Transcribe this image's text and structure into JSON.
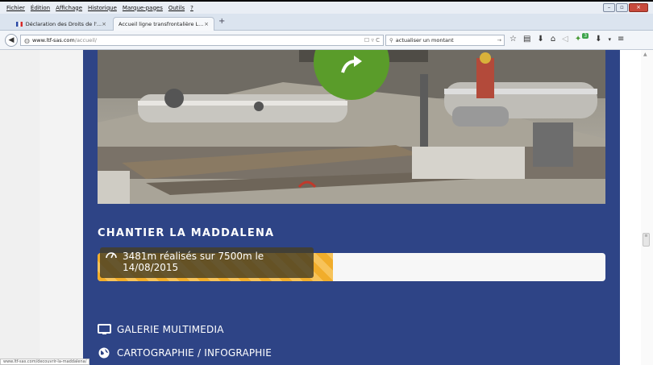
{
  "menubar": {
    "items": [
      "Fichier",
      "Édition",
      "Affichage",
      "Historique",
      "Marque-pages",
      "Outils",
      "?"
    ]
  },
  "tabs": [
    {
      "title": "Déclaration des Droits de l'...",
      "close": "×"
    },
    {
      "title": "Accueil ligne transfrontalière L...",
      "close": "×"
    }
  ],
  "new_tab": "+",
  "nav": {
    "url_domain": "www.ltf-sas.com",
    "url_path": "/accueil/",
    "search_value": "actualiser un montant",
    "download_badge": "3"
  },
  "page": {
    "section_title": "CHANTIER LA MADDALENA",
    "progress": {
      "label": "3481m réalisés sur 7500m le 14/08/2015",
      "fraction": 0.464
    },
    "links": [
      {
        "label": "GALERIE MULTIMEDIA",
        "icon": "monitor-icon"
      },
      {
        "label": "CARTOGRAPHIE / INFOGRAPHIE",
        "icon": "globe-icon"
      }
    ]
  },
  "status_url": "www.ltf-sas.com/decouvrir-la-maddalena/",
  "colors": {
    "panel": "#2e4486",
    "progress_fill": "#f1ad2b",
    "arrow_circle": "#5a9c2a"
  }
}
